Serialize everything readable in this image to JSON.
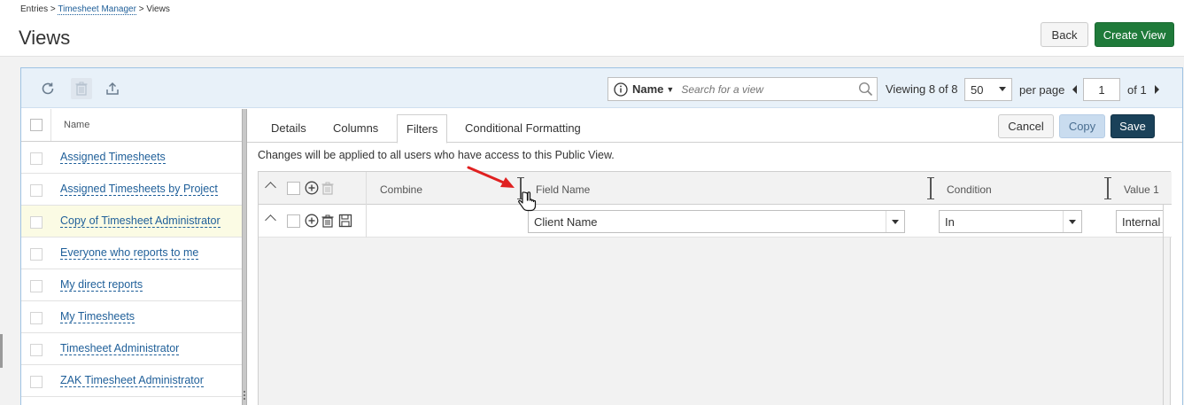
{
  "breadcrumb": {
    "entries": "Entries",
    "sep1": ">",
    "timesheet_manager": "Timesheet Manager",
    "sep2": ">",
    "views": "Views"
  },
  "page": {
    "title": "Views"
  },
  "header_buttons": {
    "back": "Back",
    "create_view": "Create View"
  },
  "toolbar": {
    "search_field": "Name",
    "search_placeholder": "Search for a view",
    "viewing_label": "Viewing",
    "viewing_count": "8 of 8",
    "per_page_value": "50",
    "per_page_label": "per page",
    "page_value": "1",
    "page_of": "of 1"
  },
  "list": {
    "header": "Name",
    "items": [
      "Assigned Timesheets",
      "Assigned Timesheets by Project",
      "Copy of Timesheet Administrator",
      "Everyone who reports to me",
      "My direct reports",
      "My Timesheets",
      "Timesheet Administrator",
      "ZAK Timesheet Administrator"
    ],
    "selected_index": 2
  },
  "tabs": [
    "Details",
    "Columns",
    "Filters",
    "Conditional Formatting"
  ],
  "active_tab": "Filters",
  "actions": {
    "cancel": "Cancel",
    "copy": "Copy",
    "save": "Save"
  },
  "notice": "Changes will be applied to all users who have access to this Public View.",
  "filter_grid": {
    "columns": {
      "combine": "Combine",
      "field_name": "Field Name",
      "condition": "Condition",
      "value1": "Value 1"
    },
    "row": {
      "field_name": "Client Name",
      "condition": "In",
      "value1": "Internal"
    }
  },
  "colors": {
    "accent_green": "#1f7a3a",
    "save_navy": "#1a4159",
    "link_blue": "#1f5f99",
    "annotation_red": "#e02020"
  }
}
